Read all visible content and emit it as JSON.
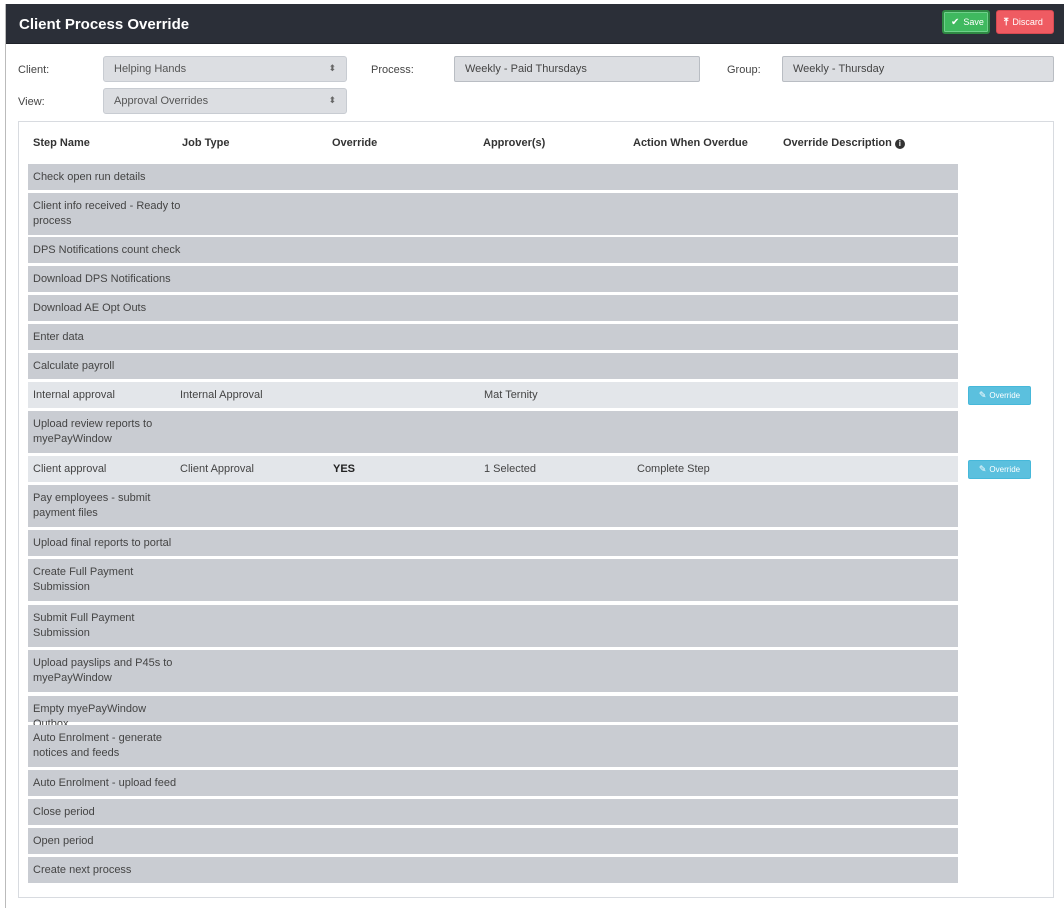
{
  "header": {
    "title": "Client Process Override",
    "save_label": "Save",
    "discard_label": "Discard"
  },
  "filters": {
    "client_label": "Client:",
    "client_value": "Helping Hands",
    "process_label": "Process:",
    "process_value": "Weekly - Paid Thursdays",
    "group_label": "Group:",
    "group_value": "Weekly - Thursday",
    "view_label": "View:",
    "view_value": "Approval Overrides"
  },
  "table": {
    "headers": {
      "step": "Step Name",
      "job": "Job Type",
      "override": "Override",
      "approvers": "Approver(s)",
      "action": "Action When Overdue",
      "description": "Override Description"
    },
    "override_button_label": "Override",
    "rows": [
      {
        "step": "Check open run details",
        "job": "",
        "override": "",
        "approvers": "",
        "action": ""
      },
      {
        "step": "Client info received - Ready to process",
        "job": "",
        "override": "",
        "approvers": "",
        "action": ""
      },
      {
        "step": "DPS Notifications count check",
        "job": "",
        "override": "",
        "approvers": "",
        "action": ""
      },
      {
        "step": "Download DPS Notifications",
        "job": "",
        "override": "",
        "approvers": "",
        "action": ""
      },
      {
        "step": "Download AE Opt Outs",
        "job": "",
        "override": "",
        "approvers": "",
        "action": ""
      },
      {
        "step": "Enter data",
        "job": "",
        "override": "",
        "approvers": "",
        "action": ""
      },
      {
        "step": "Calculate payroll",
        "job": "",
        "override": "",
        "approvers": "",
        "action": ""
      },
      {
        "step": "Internal approval",
        "job": "Internal Approval",
        "override": "",
        "approvers": "Mat Ternity",
        "action": ""
      },
      {
        "step": "Upload review reports to myePayWindow",
        "job": "",
        "override": "",
        "approvers": "",
        "action": ""
      },
      {
        "step": "Client approval",
        "job": "Client Approval",
        "override": "YES",
        "approvers": "1 Selected",
        "action": "Complete Step"
      },
      {
        "step": "Pay employees - submit payment files",
        "job": "",
        "override": "",
        "approvers": "",
        "action": ""
      },
      {
        "step": "Upload final reports to portal",
        "job": "",
        "override": "",
        "approvers": "",
        "action": ""
      },
      {
        "step": "Create Full Payment Submission",
        "job": "",
        "override": "",
        "approvers": "",
        "action": ""
      },
      {
        "step": "Submit Full Payment Submission",
        "job": "",
        "override": "",
        "approvers": "",
        "action": ""
      },
      {
        "step": "Upload payslips and P45s to myePayWindow",
        "job": "",
        "override": "",
        "approvers": "",
        "action": ""
      },
      {
        "step": "Empty myePayWindow Outbox",
        "job": "",
        "override": "",
        "approvers": "",
        "action": ""
      },
      {
        "step": "Auto Enrolment - generate notices and feeds",
        "job": "",
        "override": "",
        "approvers": "",
        "action": ""
      },
      {
        "step": "Auto Enrolment - upload feed",
        "job": "",
        "override": "",
        "approvers": "",
        "action": ""
      },
      {
        "step": "Close period",
        "job": "",
        "override": "",
        "approvers": "",
        "action": ""
      },
      {
        "step": "Open period",
        "job": "",
        "override": "",
        "approvers": "",
        "action": ""
      },
      {
        "step": "Create next process",
        "job": "",
        "override": "",
        "approvers": "",
        "action": ""
      }
    ]
  }
}
